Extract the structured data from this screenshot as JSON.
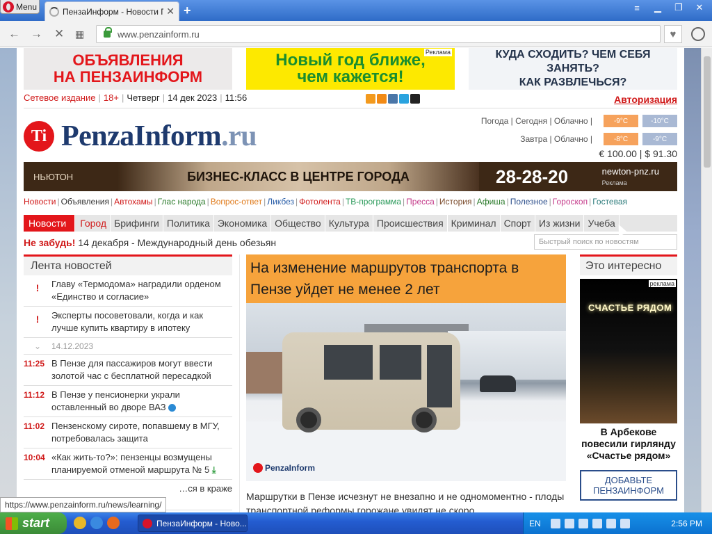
{
  "browser": {
    "menu_label": "Menu",
    "tab_title": "ПензаИнформ - Новости Пен",
    "url": "www.penzainform.ru",
    "status_url": "https://www.penzainform.ru/news/learning/"
  },
  "ads": {
    "left": [
      "ОБЪЯВЛЕНИЯ",
      "НА ПЕНЗАИНФОРМ"
    ],
    "center": [
      "Новый год ближе,",
      "чем кажется!"
    ],
    "center_tag": "Реклама",
    "right": [
      "КУДА СХОДИТЬ? ЧЕМ СЕБЯ ЗАНЯТЬ?",
      "КАК РАЗВЛЕЧЬСЯ?"
    ]
  },
  "infobar": {
    "network": "Сетевое издание",
    "age": "18+",
    "weekday": "Четверг",
    "date": "14 дек 2023",
    "time": "11:56",
    "auth": "Авторизация"
  },
  "logo": {
    "mark": "Ti",
    "name": "PenzaInform",
    "tld": ".ru"
  },
  "weather": {
    "today_label": "Погода | Сегодня | Облачно |",
    "today_day": "-9°C",
    "today_night": "-10°C",
    "tomorrow_label": "Завтра | Облачно |",
    "tomorrow_day": "-8°C",
    "tomorrow_night": "-9°C"
  },
  "currency": "€ 100.00 | $ 91.30",
  "banner": {
    "brand": "НЬЮТОН",
    "text": "БИЗНЕС-КЛАСС В ЦЕНТРЕ ГОРОДА",
    "phone": "28-28-20",
    "site": "newton-pnz.ru",
    "tag": "Реклама"
  },
  "sections": [
    {
      "label": "Новости",
      "color": "#d01a1a"
    },
    {
      "label": "Объявления",
      "color": "#333333"
    },
    {
      "label": "Автохамы",
      "color": "#d01a1a"
    },
    {
      "label": "Глас народа",
      "color": "#2a7a2a"
    },
    {
      "label": "Вопрос-ответ",
      "color": "#e07a1a"
    },
    {
      "label": "Ликбез",
      "color": "#2a5ea8"
    },
    {
      "label": "Фотолента",
      "color": "#d01a1a"
    },
    {
      "label": "ТВ-программа",
      "color": "#2a9a5a"
    },
    {
      "label": "Пресса",
      "color": "#c43a8a"
    },
    {
      "label": "История",
      "color": "#7a4a2a"
    },
    {
      "label": "Афиша",
      "color": "#2a7a2a"
    },
    {
      "label": "Полезное",
      "color": "#2a4d8a"
    },
    {
      "label": "Гороскоп",
      "color": "#c43a8a"
    },
    {
      "label": "Гостевая",
      "color": "#2a7a7a"
    }
  ],
  "menu": [
    "Новости",
    "Город",
    "Брифинги",
    "Политика",
    "Экономика",
    "Общество",
    "Культура",
    "Происшествия",
    "Криминал",
    "Спорт",
    "Из жизни",
    "Учеба"
  ],
  "reminder": {
    "label": "Не забудь!",
    "text": "14 декабря - Международный день обезьян"
  },
  "search_placeholder": "Быстрый поиск по новостям",
  "lenta": {
    "title": "Лента новостей",
    "pinned": [
      {
        "mark": "!",
        "text": "Главу «Термодома» наградили орденом «Единство и согласие»"
      },
      {
        "mark": "!",
        "text": "Эксперты посоветовали, когда и как лучше купить квартиру в ипотеку"
      }
    ],
    "date": "14.12.2023",
    "items": [
      {
        "time": "11:25",
        "text": "В Пензе для пассажиров могут ввести золотой час с бесплатной пересадкой"
      },
      {
        "time": "11:12",
        "text": "В Пензе у пенсионерки украли оставленный во дворе ВАЗ"
      },
      {
        "time": "11:02",
        "text": "Пензенскому сироте, попавшему в МГУ, потребовалась защита"
      },
      {
        "time": "10:04",
        "text": "«Как жить-то?»: пензенцы возмущены планируемой отменой маршрута № 5"
      },
      {
        "time": "",
        "text": "…ся в краже"
      }
    ]
  },
  "main": {
    "headline": "На изменение маршрутов транспорта в Пензе уйдет не менее 2 лет",
    "watermark": "PenzaInform",
    "lead": "Маршрутки в Пензе исчезнут не внезапно и не одномоментно - плоды транспортной реформы горожане увидят не скоро."
  },
  "interesting": {
    "title": "Это интересно",
    "image_text": "СЧАСТЬЕ РЯДОМ",
    "ad_tag": "реклама",
    "caption": "В Арбекове повесили гирлянду «Счастье рядом»",
    "promo": "ДОБАВЬТЕ ПЕНЗАИНФОРМ"
  },
  "taskbar": {
    "start": "start",
    "task": "ПензаИнформ - Ново...",
    "lang": "EN",
    "clock": "2:56 PM"
  }
}
